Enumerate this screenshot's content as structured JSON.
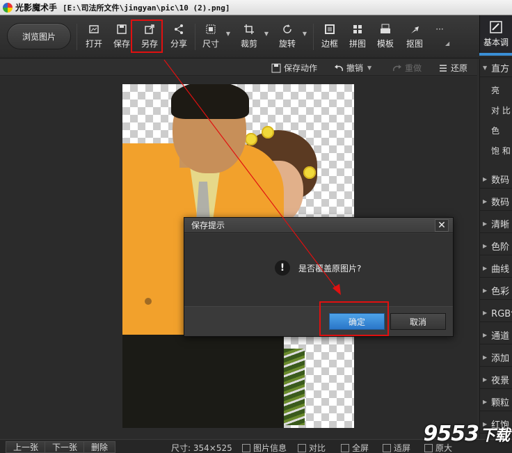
{
  "titlebar": {
    "app_name": "光影魔术手",
    "file_path": "[E:\\司法所文件\\jingyan\\pic\\10 (2).png]"
  },
  "toolbar": {
    "browse_label": "浏览图片",
    "tools": [
      {
        "label": "打开",
        "icon": "open-image-icon"
      },
      {
        "label": "保存",
        "icon": "save-icon"
      },
      {
        "label": "另存",
        "icon": "save-as-icon"
      },
      {
        "label": "分享",
        "icon": "share-icon"
      },
      {
        "label": "尺寸",
        "icon": "resize-icon"
      },
      {
        "label": "裁剪",
        "icon": "crop-icon"
      },
      {
        "label": "旋转",
        "icon": "rotate-icon"
      },
      {
        "label": "边框",
        "icon": "border-icon"
      },
      {
        "label": "拼图",
        "icon": "collage-icon"
      },
      {
        "label": "模板",
        "icon": "template-icon"
      },
      {
        "label": "抠图",
        "icon": "cutout-icon"
      },
      {
        "label": "···",
        "icon": "more-icon"
      }
    ],
    "right_tab_label": "基本调"
  },
  "actionbar": {
    "save_action": "保存动作",
    "undo": "撤销",
    "redo": "重做",
    "restore": "还原"
  },
  "right_panel": {
    "header": "直方",
    "sliders": [
      "亮",
      "对 比",
      "色",
      "饱 和"
    ],
    "sections": [
      "数码",
      "数码",
      "清晰",
      "色阶",
      "曲线",
      "色彩",
      "RGB色",
      "通道",
      "添加",
      "夜景",
      "颗粒",
      "红饱"
    ]
  },
  "dialog": {
    "title": "保存提示",
    "message": "是否覆盖原图片?",
    "ok": "确定",
    "cancel": "取消",
    "close": "✕"
  },
  "statusbar": {
    "prev": "上一张",
    "next": "下一张",
    "delete": "删除",
    "size": "尺寸: 354×525",
    "info": "图片信息",
    "compare": "对比",
    "fullscreen": "全屏",
    "fit": "适屏",
    "original": "原大"
  },
  "watermark": {
    "num": "9553",
    "cn": "下载"
  },
  "colors": {
    "highlight": "#e01010",
    "accent": "#3a8fd6",
    "ok_button": "#2a76c8"
  }
}
